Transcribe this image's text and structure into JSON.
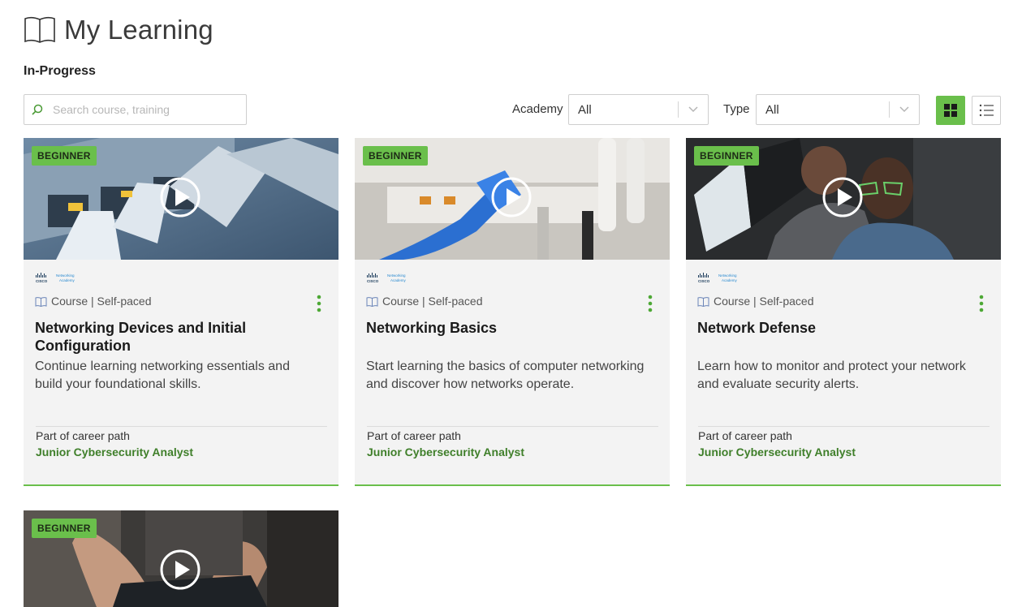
{
  "header": {
    "title": "My Learning",
    "icon": "book-icon"
  },
  "section": {
    "title": "In-Progress"
  },
  "search": {
    "placeholder": "Search course, training",
    "value": ""
  },
  "filters": {
    "academy": {
      "label": "Academy",
      "value": "All"
    },
    "type": {
      "label": "Type",
      "value": "All"
    }
  },
  "view_toggle": {
    "active": "grid",
    "options": [
      "grid",
      "list"
    ]
  },
  "colors": {
    "accent": "#6abf4b",
    "path_text": "#3f7f2a",
    "card_bg": "#f3f3f3"
  },
  "cards": [
    {
      "badge": "BEGINNER",
      "provider": "Networking Academy",
      "type": "Course",
      "pace": "Self-paced",
      "meta": "Course | Self-paced",
      "title": "Networking Devices and Initial Configuration",
      "description": "Continue learning networking essentials and build your foundational skills.",
      "path_label": "Part of career path",
      "path_name": "Junior Cybersecurity Analyst"
    },
    {
      "badge": "BEGINNER",
      "provider": "Networking Academy",
      "type": "Course",
      "pace": "Self-paced",
      "meta": "Course | Self-paced",
      "title": "Networking Basics",
      "description": "Start learning the basics of computer networking and discover how networks operate.",
      "path_label": "Part of career path",
      "path_name": "Junior Cybersecurity Analyst"
    },
    {
      "badge": "BEGINNER",
      "provider": "Networking Academy",
      "type": "Course",
      "pace": "Self-paced",
      "meta": "Course | Self-paced",
      "title": "Network Defense",
      "description": "Learn how to monitor and protect your network and evaluate security alerts.",
      "path_label": "Part of career path",
      "path_name": "Junior Cybersecurity Analyst"
    },
    {
      "badge": "BEGINNER"
    }
  ]
}
